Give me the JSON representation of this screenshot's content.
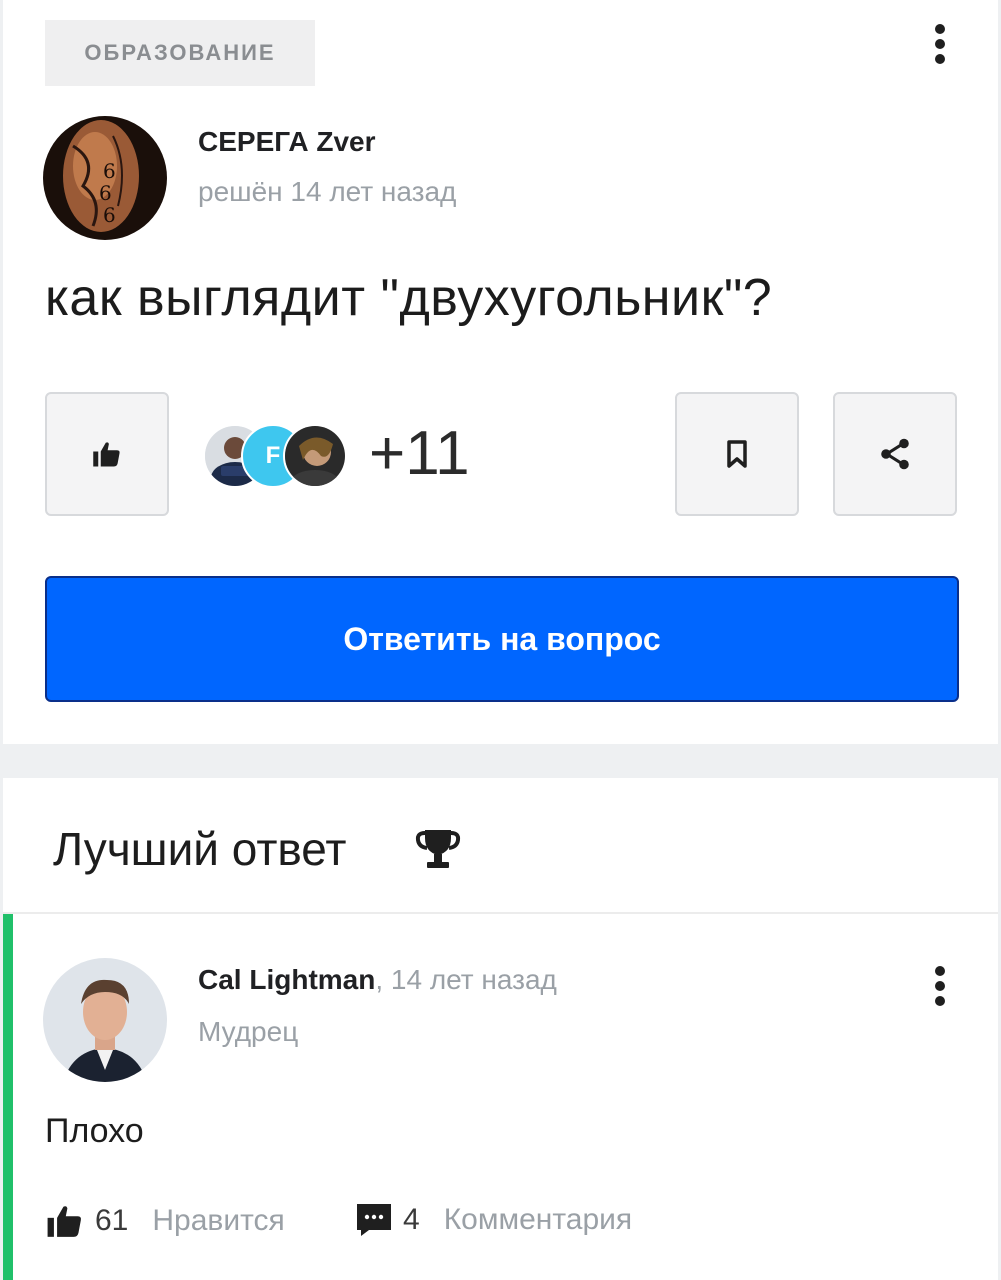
{
  "question": {
    "category": "ОБРАЗОВАНИЕ",
    "author": {
      "name": "СЕРЕГА Zver",
      "status": "решён 14 лет назад"
    },
    "title": "как выглядит \"двухугольник\"?",
    "liker_letter": "F",
    "likes_more": "+11",
    "answer_button": "Ответить на вопрос"
  },
  "best_answer": {
    "heading": "Лучший ответ",
    "author": {
      "name": "Cal Lightman",
      "time": ", 14 лет назад",
      "rank": "Мудрец"
    },
    "text": "Плохо",
    "likes": {
      "count": "61",
      "label": "Нравится"
    },
    "comments": {
      "count": "4",
      "label": "Комментария"
    }
  },
  "colors": {
    "primary": "#0066ff",
    "best_accent": "#20c06a"
  }
}
